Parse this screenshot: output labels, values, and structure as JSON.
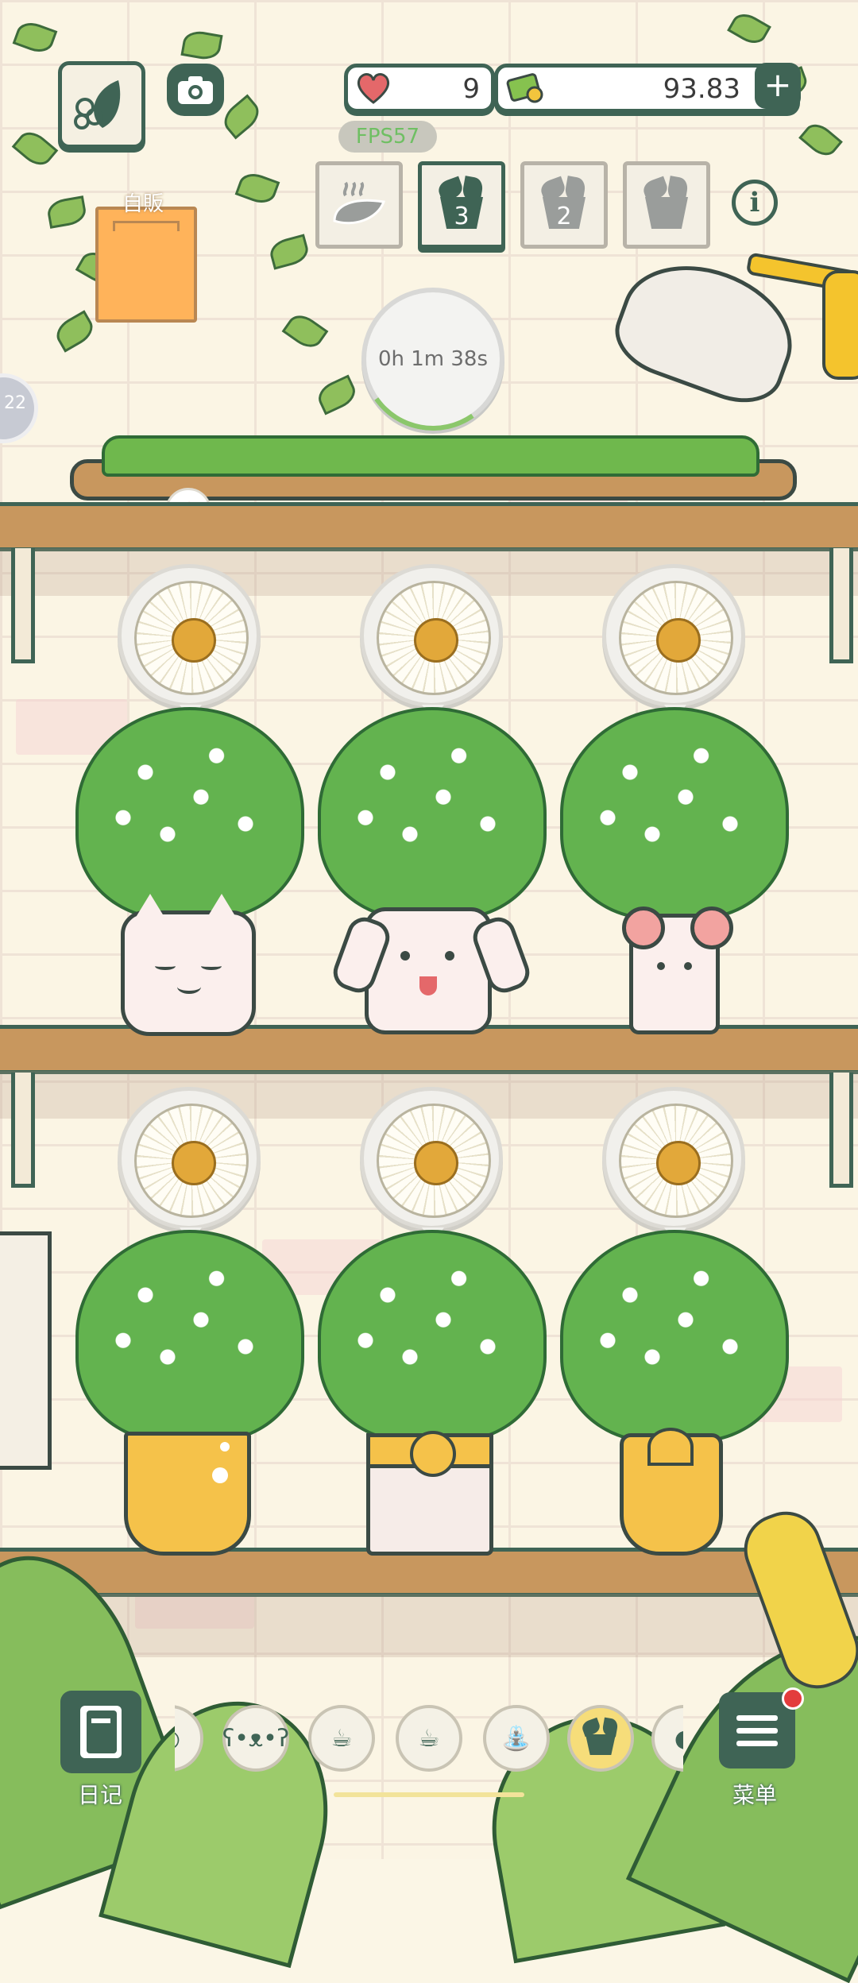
{
  "top_bar": {
    "hearts_value": "9",
    "money_value": "93.83",
    "plus_label": "+",
    "fps_label": "FPS57"
  },
  "shop_sign": {
    "label": "自販"
  },
  "seed_slots": [
    {
      "label": ""
    },
    {
      "label": "3"
    },
    {
      "label": "2"
    },
    {
      "label": ""
    }
  ],
  "info_label": "i",
  "timer": {
    "label": "0h 1m 38s",
    "progress": 0.12
  },
  "left_badge": "22",
  "shelves": {
    "top": [
      "daisy-pot-cat",
      "daisy-pot-dog",
      "daisy-pot-bunny"
    ],
    "bottom": [
      "daisy-pot-yellow",
      "daisy-pot-white-flower",
      "daisy-pot-tulip"
    ]
  },
  "bottom_bar": {
    "diary_label": "日记",
    "menu_label": "菜单",
    "tools": [
      "bear-icon",
      "cup-icon",
      "cup-icon",
      "watering-can-icon",
      "plant-pot-icon"
    ]
  },
  "colors": {
    "accent": "#3f6455",
    "shelf": "#c8975e",
    "wall": "#fbf5e4",
    "leaf": "#63b34f"
  }
}
